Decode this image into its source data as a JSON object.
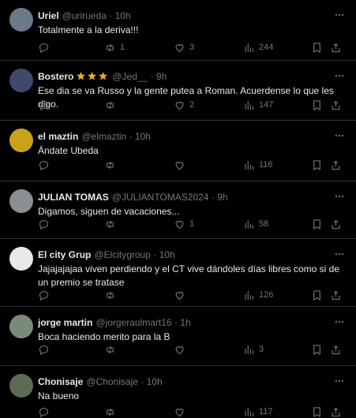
{
  "tweets": [
    {
      "name": "Uriel",
      "handle": "@urirueda",
      "time": "10h",
      "text": "Totalmente a la deriva!!!",
      "replies": "",
      "retweets": "1",
      "likes": "3",
      "views": "244",
      "verified_stars": false,
      "avatar_color": "#6b7a8a"
    },
    {
      "name": "Bostero",
      "handle": "@Jed__",
      "time": "9h",
      "text": "Ese dia se va Russo y la gente putea a Roman. Acuerdense lo que les digo.",
      "replies": "",
      "retweets": "",
      "likes": "2",
      "views": "147",
      "verified_stars": true,
      "avatar_color": "#3f4a6b"
    },
    {
      "name": "el maztin",
      "handle": "@elmaztin",
      "time": "10h",
      "text": "Ándate Ubeda",
      "replies": "",
      "retweets": "",
      "likes": "",
      "views": "116",
      "verified_stars": false,
      "avatar_color": "#c9a21a"
    },
    {
      "name": "JULIAN TOMAS",
      "handle": "@JULIANTOMAS2024",
      "time": "9h",
      "text": "Digamos, siguen de vacaciones...",
      "replies": "",
      "retweets": "",
      "likes": "1",
      "views": "58",
      "verified_stars": false,
      "avatar_color": "#8a8f94"
    },
    {
      "name": "El city Grup",
      "handle": "@Elcitygroup",
      "time": "10h",
      "text": "Jajajajajaa viven perdiendo y el CT vive dándoles días libres como si de un premio se tratase",
      "replies": "",
      "retweets": "",
      "likes": "",
      "views": "126",
      "verified_stars": false,
      "avatar_color": "#e8e8e8"
    },
    {
      "name": "jorge martin",
      "handle": "@jorgeraulmart16",
      "time": "1h",
      "text": "Boca haciendo merito para la B",
      "replies": "",
      "retweets": "",
      "likes": "",
      "views": "3",
      "verified_stars": false,
      "avatar_color": "#7a8a7a"
    },
    {
      "name": "Chonisaje",
      "handle": "@Chonisaje",
      "time": "10h",
      "text": "Na bueno",
      "replies": "",
      "retweets": "",
      "likes": "",
      "views": "117",
      "verified_stars": false,
      "avatar_color": "#5d6b55"
    }
  ],
  "separator": "·",
  "colors": {
    "background": "#000000",
    "text": "#e7e9ea",
    "muted": "#71767b",
    "border": "#2f3336",
    "star": "#f5a623"
  }
}
